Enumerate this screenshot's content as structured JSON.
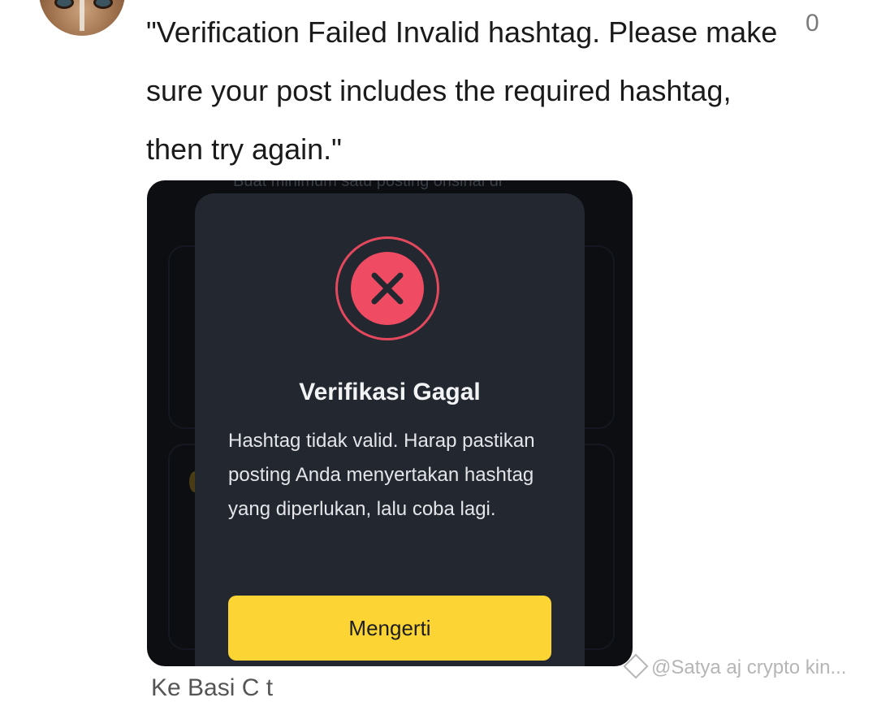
{
  "comment": {
    "text": "\"Verification Failed Invalid hashtag. Please make sure your post includes the required hashtag, then try again.\"",
    "like_count": "0"
  },
  "screenshot": {
    "background_hint": "Buat minimum satu posting orisinal di",
    "dialog": {
      "icon": "error-x-icon",
      "title": "Verifikasi Gagal",
      "message": "Hashtag tidak valid. Harap pastikan posting Anda menyertakan hashtag yang diperlukan, lalu coba lagi.",
      "button_label": "Mengerti"
    }
  },
  "below": {
    "text": "Ke     Basi    C   t"
  },
  "watermark": {
    "text": "@Satya  aj crypto kin..."
  },
  "colors": {
    "dialog_bg": "#232730",
    "error_red": "#ef4b63",
    "button_yellow": "#fcd535"
  }
}
